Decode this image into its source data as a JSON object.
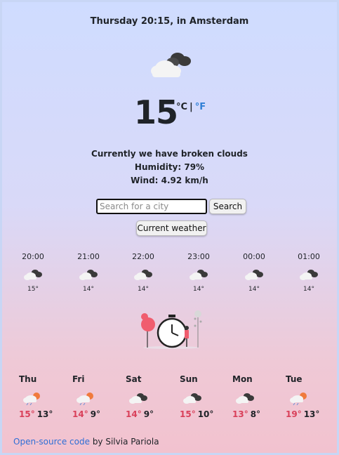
{
  "header": {
    "datetime": "Thursday 20:15, in Amsterdam"
  },
  "current": {
    "icon": "broken-clouds-icon",
    "temperature": "15",
    "unit_c": "°C",
    "unit_separator": "|",
    "unit_f": "°F",
    "description": "Currently we have broken clouds",
    "humidity": "Humidity: 79%",
    "wind": "Wind: 4.92 km/h"
  },
  "search": {
    "placeholder": "Search for a city",
    "search_label": "Search",
    "current_label": "Current weather"
  },
  "hourly": [
    {
      "time": "20:00",
      "icon": "broken-clouds-icon",
      "temp": "15°"
    },
    {
      "time": "21:00",
      "icon": "broken-clouds-icon",
      "temp": "14°"
    },
    {
      "time": "22:00",
      "icon": "broken-clouds-icon",
      "temp": "14°"
    },
    {
      "time": "23:00",
      "icon": "broken-clouds-icon",
      "temp": "14°"
    },
    {
      "time": "00:00",
      "icon": "broken-clouds-icon",
      "temp": "14°"
    },
    {
      "time": "01:00",
      "icon": "broken-clouds-icon",
      "temp": "14°"
    }
  ],
  "daily": [
    {
      "day": "Thu",
      "icon": "sun-rain-cloud-icon",
      "high": "15°",
      "low": "13°"
    },
    {
      "day": "Fri",
      "icon": "sun-rain-cloud-icon",
      "high": "14°",
      "low": "9°"
    },
    {
      "day": "Sat",
      "icon": "broken-clouds-icon",
      "high": "14°",
      "low": "9°"
    },
    {
      "day": "Sun",
      "icon": "broken-clouds-icon",
      "high": "15°",
      "low": "10°"
    },
    {
      "day": "Mon",
      "icon": "broken-clouds-icon",
      "high": "13°",
      "low": "8°"
    },
    {
      "day": "Tue",
      "icon": "sun-rain-cloud-icon",
      "high": "19°",
      "low": "13°"
    }
  ],
  "footer": {
    "link_text": "Open-source code",
    "suffix": "by Silvia Pariola"
  },
  "colors": {
    "accent_link": "#2f7fd6",
    "high_temp": "#d9405a",
    "bg_top": "#cfdcff",
    "bg_bottom": "#f2c2cf"
  }
}
